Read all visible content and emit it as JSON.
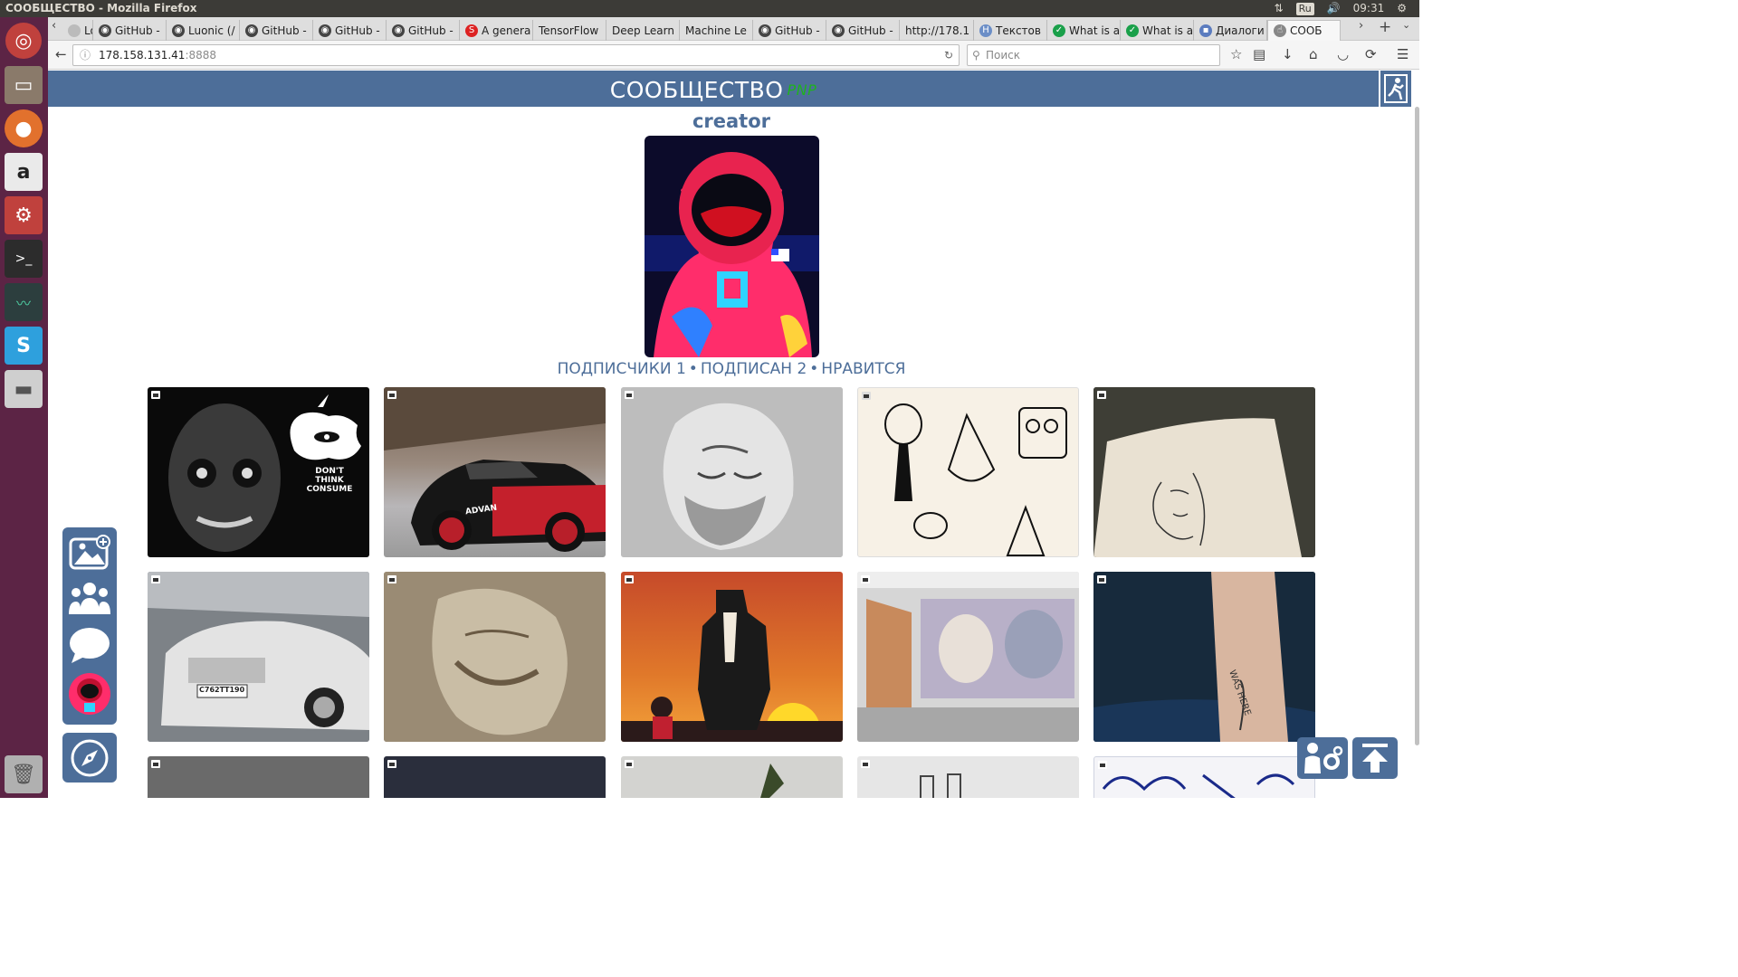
{
  "system": {
    "window_title": "СООБЩЕСТВО - Mozilla Firefox",
    "keyboard_layout": "Ru",
    "clock": "09:31"
  },
  "browser": {
    "tabs": [
      {
        "label": "Lonc",
        "icon": "partial-tab-icon"
      },
      {
        "label": "GitHub -",
        "icon": "github-icon"
      },
      {
        "label": "Luonic (/",
        "icon": "github-icon"
      },
      {
        "label": "GitHub -",
        "icon": "github-icon"
      },
      {
        "label": "GitHub -",
        "icon": "github-icon"
      },
      {
        "label": "GitHub -",
        "icon": "github-icon"
      },
      {
        "label": "A genera",
        "icon": "s-icon"
      },
      {
        "label": "TensorFlow",
        "icon": "none"
      },
      {
        "label": "Deep Learn",
        "icon": "none"
      },
      {
        "label": "Machine Le",
        "icon": "none"
      },
      {
        "label": "GitHub -",
        "icon": "github-icon"
      },
      {
        "label": "GitHub -",
        "icon": "github-icon"
      },
      {
        "label": "http://178.1",
        "icon": "none"
      },
      {
        "label": "Текстов",
        "icon": "h-icon"
      },
      {
        "label": "What is a",
        "icon": "green-icon"
      },
      {
        "label": "What is a",
        "icon": "green-icon"
      },
      {
        "label": "Диалоги",
        "icon": "vk-icon"
      },
      {
        "label": "СООБ",
        "icon": "hand-icon",
        "active": true
      }
    ],
    "url_host": "178.158.131.41",
    "url_port": ":8888",
    "search_placeholder": "Поиск"
  },
  "site": {
    "brand": "СООБЩЕСТВО",
    "beta": "PNP",
    "accent_color": "#4d6e99",
    "profile": {
      "username": "creator",
      "followers_label": "ПОДПИСЧИКИ 1",
      "following_label": "ПОДПИСАН 2",
      "likes_label": "НРАВИТСЯ",
      "separator": "•"
    },
    "posts": [
      {
        "subject": "skull-apple-poster",
        "caption": "DON'T THINK\nCONSUME"
      },
      {
        "subject": "red-black-sports-car",
        "caption": "ADVAN"
      },
      {
        "subject": "pencil-sculpture-head",
        "caption": ""
      },
      {
        "subject": "cartoon-sketches",
        "caption": ""
      },
      {
        "subject": "sketchbook-face",
        "caption": ""
      },
      {
        "subject": "white-mercedes",
        "caption": "С762ТТ190"
      },
      {
        "subject": "sepia-sculpture-head",
        "caption": ""
      },
      {
        "subject": "cartoon-wolverine",
        "caption": ""
      },
      {
        "subject": "gallery-mural",
        "caption": ""
      },
      {
        "subject": "arm-tattoo",
        "caption": ""
      },
      {
        "subject": "car-interior",
        "caption": ""
      },
      {
        "subject": "dark-doorway",
        "caption": ""
      },
      {
        "subject": "green-object",
        "caption": ""
      },
      {
        "subject": "sketch-objects",
        "caption": ""
      },
      {
        "subject": "doodle-illustration",
        "caption": ""
      }
    ]
  }
}
